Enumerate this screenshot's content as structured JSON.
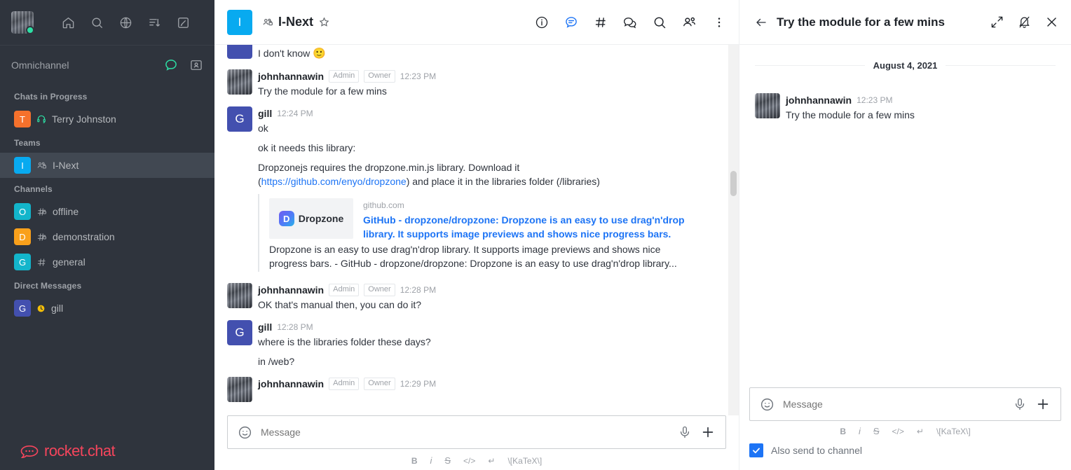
{
  "sidebar": {
    "user_avatar_status": "online",
    "top_icons": [
      "home-icon",
      "search-icon",
      "globe-icon",
      "sort-icon",
      "create-new-icon"
    ],
    "omnichannel_label": "Omnichannel",
    "sections": [
      {
        "title": "Chats in Progress",
        "items": [
          {
            "label": "Terry Johnston",
            "initial": "T",
            "color": "#F5712C",
            "type_icon": "livechat-icon"
          }
        ]
      },
      {
        "title": "Teams",
        "items": [
          {
            "label": "I-Next",
            "initial": "I",
            "color": "#08AAF0",
            "type_icon": "team-private-icon",
            "active": true
          }
        ]
      },
      {
        "title": "Channels",
        "items": [
          {
            "label": "offline",
            "initial": "O",
            "color": "#13B5CB",
            "type_icon": "hashtag-lock-icon"
          },
          {
            "label": "demonstration",
            "initial": "D",
            "color": "#F9A01B",
            "type_icon": "hashtag-lock-icon"
          },
          {
            "label": "general",
            "initial": "G",
            "color": "#13B5CB",
            "type_icon": "hashtag-icon"
          }
        ]
      },
      {
        "title": "Direct Messages",
        "items": [
          {
            "label": "gill",
            "initial": "G",
            "color": "#4350AF",
            "type_icon": "away-status-icon"
          }
        ]
      }
    ],
    "logo_text": "rocket.chat",
    "logo_color": "#F5455C"
  },
  "chat_header": {
    "avatar_initial": "I",
    "avatar_color": "#08AAF0",
    "title": "I-Next",
    "team_icon": "team-private-icon",
    "favorite_icon": "star-outline-icon",
    "actions": [
      "info-circle-icon",
      "threads-icon",
      "hashtag-icon",
      "discussion-icon",
      "search-icon",
      "team-members-icon",
      "kebab-menu-icon"
    ],
    "active_action": "threads-icon",
    "accent_color": "#1D74F5"
  },
  "messages": [
    {
      "id": "m0",
      "partial": true,
      "avatar_color": "#4350AF",
      "text": "I don't know",
      "emoji": "🙂"
    },
    {
      "id": "m1",
      "user": "johnhannawin",
      "avatar_type": "photo",
      "tags": [
        "Admin",
        "Owner"
      ],
      "time": "12:23 PM",
      "texts": [
        "Try the module for a few mins"
      ]
    },
    {
      "id": "m2",
      "user": "gill",
      "avatar_initial": "G",
      "avatar_color": "#4350AF",
      "tags": [],
      "time": "12:24 PM",
      "texts": [
        "ok",
        "ok it needs this library:"
      ]
    },
    {
      "id": "m3",
      "user": "johnhannawin",
      "avatar_type": "photo",
      "tags": [
        "Admin",
        "Owner"
      ],
      "time": "12:28 PM",
      "texts": [
        "OK that's manual then, you can do it?"
      ]
    },
    {
      "id": "m4",
      "user": "gill",
      "avatar_initial": "G",
      "avatar_color": "#4350AF",
      "tags": [],
      "time": "12:28 PM",
      "texts": [
        "where is the libraries folder these days?",
        "in /web?"
      ]
    },
    {
      "id": "m5",
      "user": "johnhannawin",
      "avatar_type": "photo",
      "tags": [
        "Admin",
        "Owner"
      ],
      "time": "12:29 PM",
      "texts": [
        ""
      ]
    }
  ],
  "dropzone_message": {
    "line_prefix": "Dropzonejs requires the dropzone.min.js library. Download it",
    "line_open_paren": "(",
    "link_text": "https://github.com/enyo/dropzone",
    "line_suffix": ") and place it in the libraries folder (/libraries)"
  },
  "link_preview": {
    "logo_letter": "D",
    "logo_text": "Dropzone",
    "site": "github.com",
    "title": "GitHub - dropzone/dropzone: Dropzone is an easy to use drag'n'drop library. It supports image previews and shows nice progress bars.",
    "description": "Dropzone is an easy to use drag'n'drop library. It supports image previews and shows nice progress bars. - GitHub - dropzone/dropzone: Dropzone is an easy to use drag'n'drop library..."
  },
  "composer": {
    "placeholder": "Message",
    "emoji_icon": "emoji-icon",
    "mic_icon": "microphone-icon",
    "plus_icon": "plus-icon",
    "format": {
      "bold": "B",
      "italic": "i",
      "strike": "S",
      "code": "</>",
      "multiline": "↵",
      "katex": "\\[KaTeX\\]"
    }
  },
  "thread": {
    "back_icon": "arrow-left-icon",
    "title": "Try the module for a few mins",
    "expand_icon": "expand-icon",
    "bell_off_icon": "bell-off-icon",
    "close_icon": "close-icon",
    "date_divider": "August 4, 2021",
    "message": {
      "user": "johnhannawin",
      "time": "12:23 PM",
      "text": "Try the module for a few mins"
    },
    "composer": {
      "placeholder": "Message"
    },
    "also_send_label": "Also send to channel",
    "also_send_checked": true,
    "checkbox_color": "#1D74F5"
  }
}
